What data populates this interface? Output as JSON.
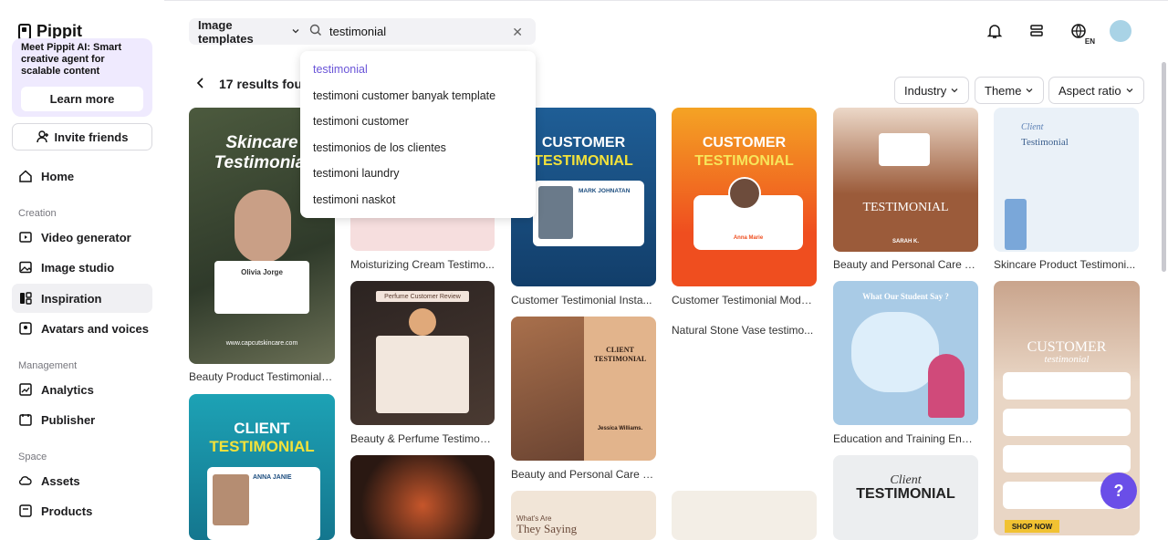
{
  "app": {
    "logo": "Pippit"
  },
  "sidebar": {
    "promo_text": "Meet Pippit AI: Smart creative agent for scalable content",
    "promo_button": "Learn more",
    "invite_label": "Invite friends",
    "home": "Home",
    "creation_label": "Creation",
    "creation_items": [
      "Video generator",
      "Image studio",
      "Inspiration",
      "Avatars and voices"
    ],
    "management_label": "Management",
    "management_items": [
      "Analytics",
      "Publisher"
    ],
    "space_label": "Space",
    "space_items": [
      "Assets",
      "Products"
    ]
  },
  "search": {
    "category": "Image templates",
    "query": "testimonial",
    "suggestions": [
      "testimonial",
      "testimoni customer banyak template",
      "testimoni customer",
      "testimonios de los clientes",
      "testimoni laundry",
      "testimoni naskot"
    ]
  },
  "header": {
    "lang": "EN"
  },
  "results": {
    "title": "17 results found",
    "filters": [
      "Industry",
      "Theme",
      "Aspect ratio"
    ]
  },
  "cards": {
    "c1_caption": "Beauty Product Testimonial ...",
    "c2_caption": "Moisturizing Cream Testimo...",
    "c3_caption": "Customer Testimonial Insta...",
    "c4_caption": "Customer Testimonial Mode...",
    "c5_caption": "Beauty and Personal Care T...",
    "c6_caption": "Skincare Product Testimoni...",
    "c7_caption": "Beauty & Perfume Testimon...",
    "c8_caption": "Beauty and Personal Care S...",
    "c9_caption": "Natural Stone Vase testimo...",
    "c10_caption": "Education and Training Engli...",
    "c1_text": "Skincare Testimonial",
    "c1_name": "Olivia Jorge",
    "c1_url": "www.capcutskincare.com",
    "c3_t1": "CUSTOMER",
    "c3_t2": "TESTIMONIAL",
    "c3_name": "MARK JOHNATAN",
    "c4_t1": "CUSTOMER",
    "c4_t2": "TESTIMONIAL",
    "c4_name": "Anna Marie",
    "c5_t": "TESTIMONIAL",
    "c5_name": "SARAH K.",
    "c6_t1": "Client",
    "c6_t2": "Testimonial",
    "c7_tag": "Perfume Customer Review",
    "c8_t1": "CLIENT",
    "c8_t2": "TESTIMONIAL",
    "c8_name": "Jessica Williams.",
    "c10_t": "What Our Student Say ?",
    "c11_t1": "CLIENT",
    "c11_t2": "TESTIMONIAL",
    "c11_name": "ANNA JANIE",
    "c13_t": "CUSTOMER",
    "c13_t2": "testimonial",
    "c13_btn": "SHOP NOW",
    "c14_t1": "Client",
    "c14_t2": "TESTIMONIAL",
    "c15_t": "They Saying",
    "c15_sub": "What's Are"
  },
  "colors": {
    "accent": "#6a4ee8",
    "suggestion_highlight": "#6a55d8"
  }
}
